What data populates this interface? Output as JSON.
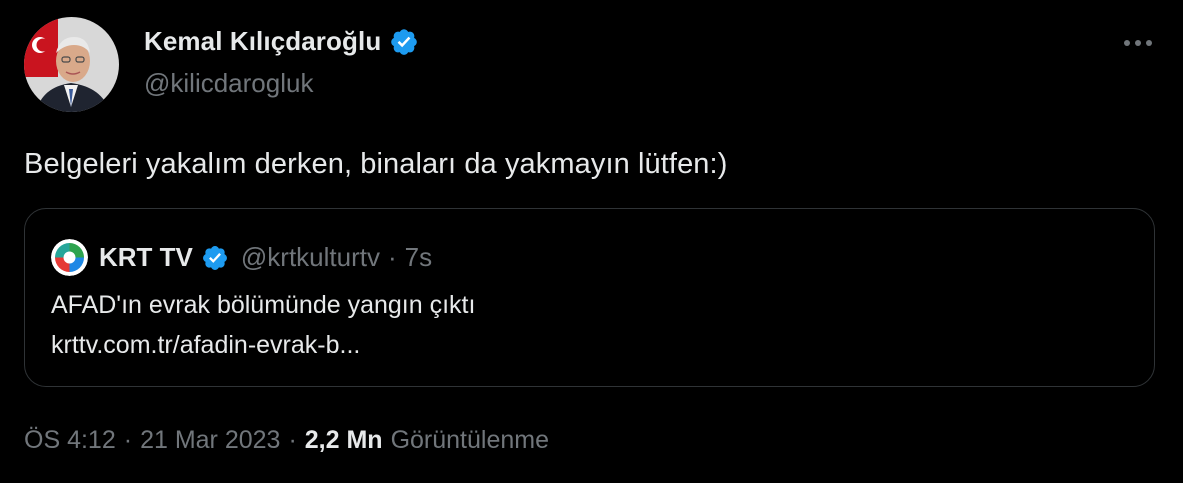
{
  "author": {
    "display_name": "Kemal Kılıçdaroğlu",
    "handle": "@kilicdarogluk",
    "verified_icon": "verified-badge-icon"
  },
  "more_icon": "more-horizontal-icon",
  "tweet": {
    "text": "Belgeleri yakalım derken, binaları da yakmayın lütfen:)"
  },
  "quoted": {
    "display_name": "KRT TV",
    "handle": "@krtkulturtv",
    "separator": "·",
    "time": "7s",
    "line1": "AFAD'ın evrak bölümünde yangın çıktı",
    "line2": "krttv.com.tr/afadin-evrak-b..."
  },
  "footer": {
    "time": "ÖS 4:12",
    "sep1": "·",
    "date": "21 Mar 2023",
    "sep2": "·",
    "views_count": "2,2 Mn",
    "views_label": "Görüntülenme"
  },
  "colors": {
    "background": "#000000",
    "text_primary": "#e7e9ea",
    "text_secondary": "#71767b",
    "border": "#2f3336",
    "verified_blue": "#1d9bf0"
  }
}
